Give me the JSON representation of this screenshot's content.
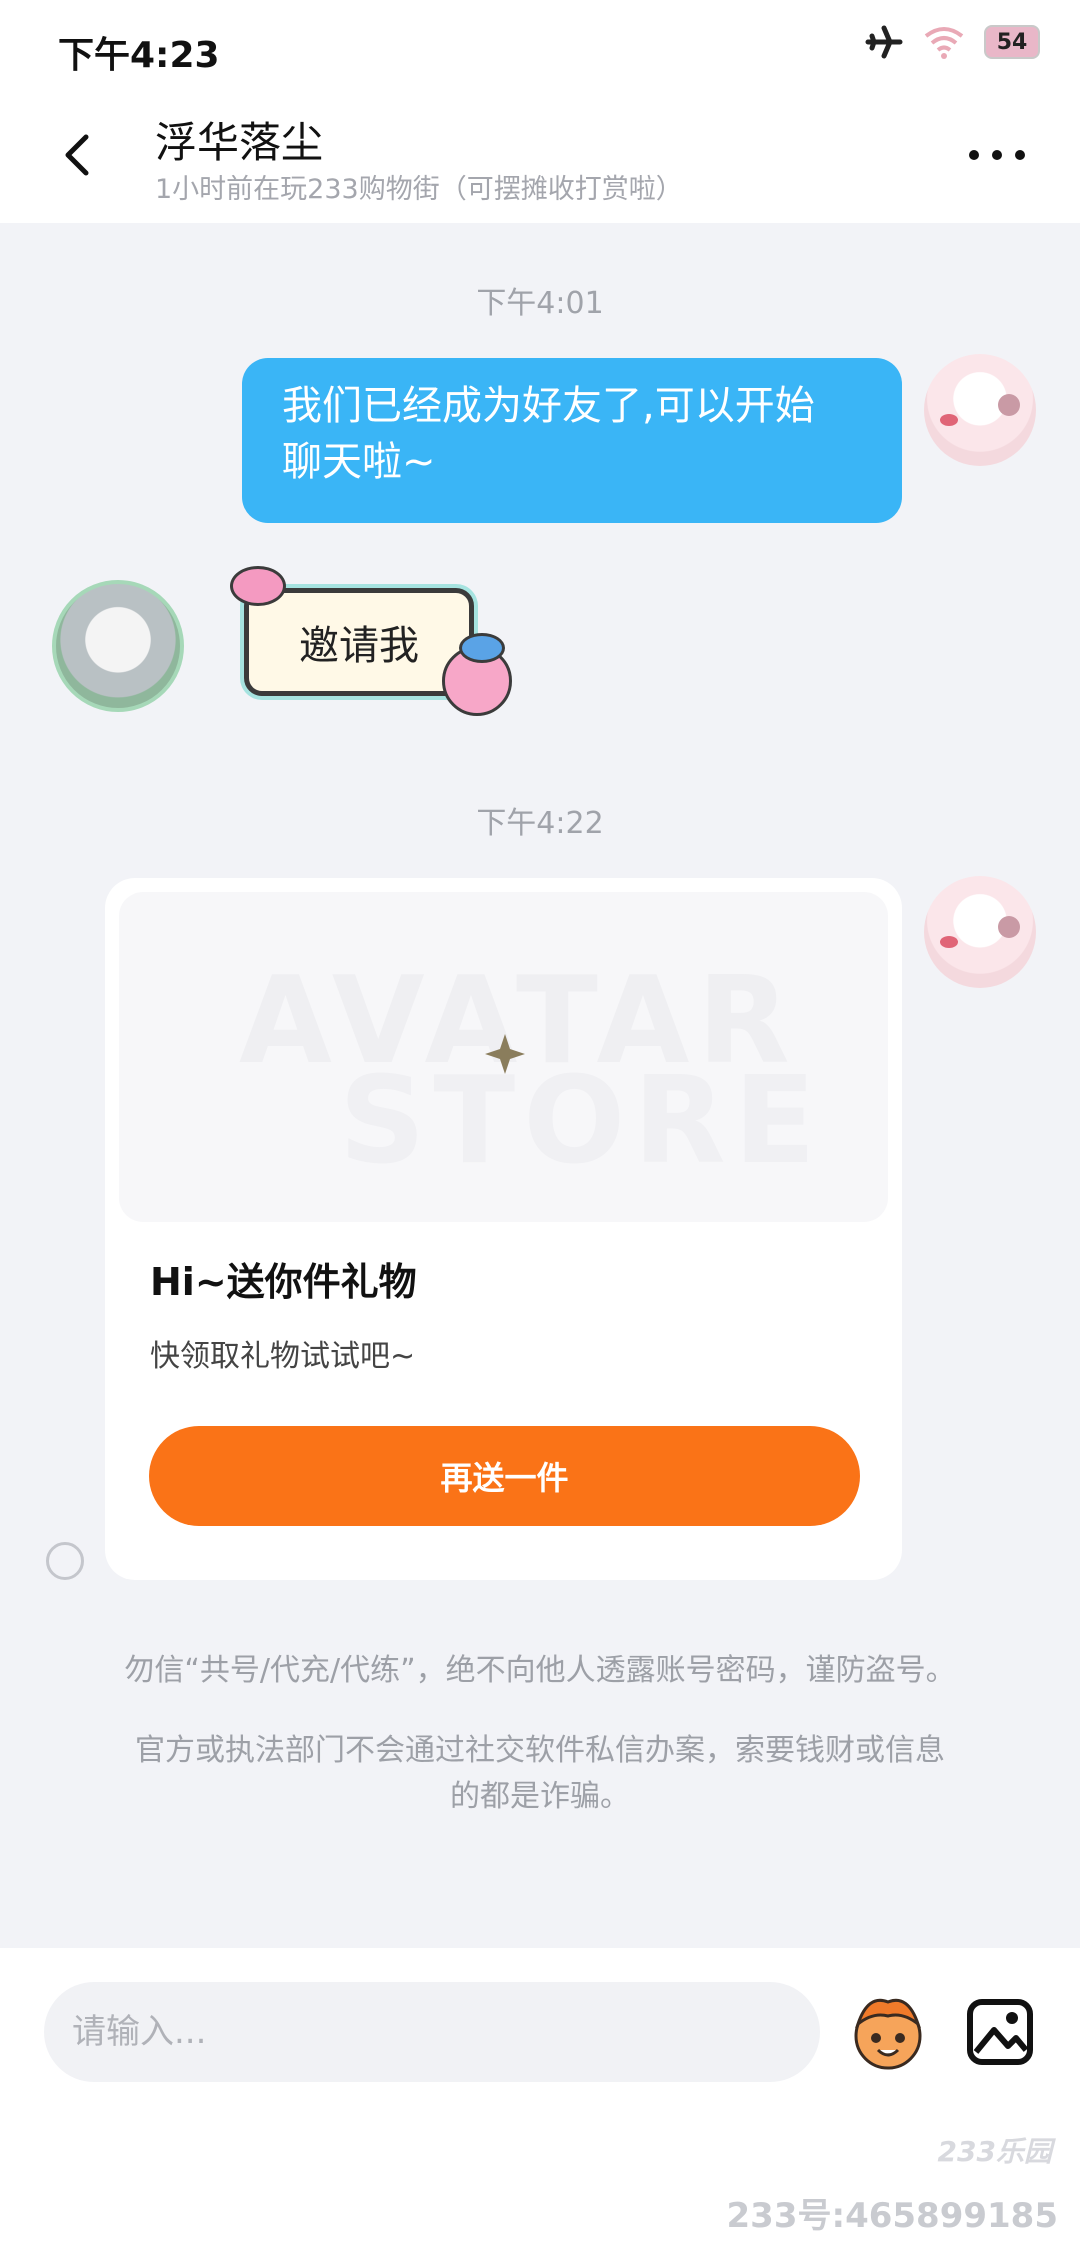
{
  "status_bar": {
    "time": "下午4:23",
    "battery": "54"
  },
  "header": {
    "title": "浮华落尘",
    "subtitle": "1小时前在玩233购物街（可摆摊收打赏啦）"
  },
  "messages": {
    "timestamp1": "下午4:01",
    "outgoing_text_line1": "我们已经成为好友了,可以开始",
    "outgoing_text_line2": "聊天啦~",
    "sticker_text": "邀请我",
    "timestamp2": "下午4:22",
    "gift_card": {
      "image_watermark_top": "AVATAR",
      "image_watermark_bottom": "STORE",
      "title": "Hi~送你件礼物",
      "description": "快领取礼物试试吧~",
      "button": "再送一件"
    }
  },
  "notices": {
    "line1": "勿信“共号/代充/代练”，绝不向他人透露账号密码，谨防盗号。",
    "line2a": "官方或执法部门不会通过社交软件私信办案，索要钱财或信息",
    "line2b": "的都是诈骗。"
  },
  "input": {
    "placeholder": "请输入..."
  },
  "watermark": {
    "logo": "233乐园",
    "id": "233号:465899185"
  },
  "colors": {
    "accent_blue": "#3ab5f6",
    "accent_orange": "#fa7317"
  },
  "icons": [
    "back-arrow-icon",
    "more-dots-icon",
    "airplane-icon",
    "wifi-icon",
    "emoji-icon",
    "image-icon",
    "sparkle-icon"
  ]
}
